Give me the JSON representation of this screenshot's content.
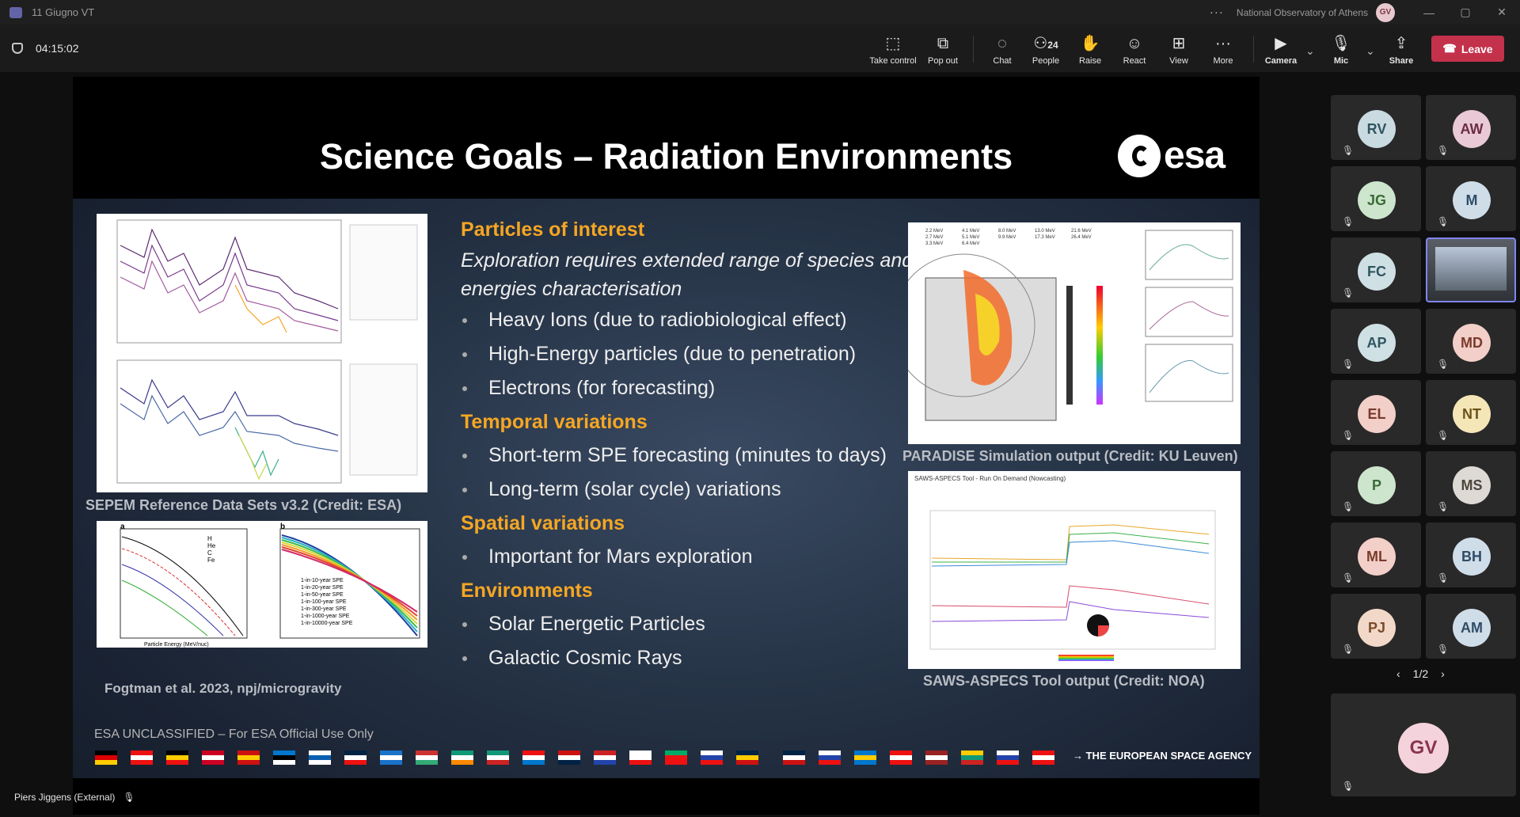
{
  "window": {
    "title": "11 Giugno VT",
    "organization": "National Observatory of Athens",
    "user_initials": "GV",
    "controls": [
      "—",
      "▢",
      "✕"
    ]
  },
  "meeting": {
    "timer": "04:15:02",
    "toolbar": [
      {
        "label": "Take control",
        "icon": "take-control-icon"
      },
      {
        "label": "Pop out",
        "icon": "pop-out-icon"
      },
      {
        "label": "Chat",
        "icon": "chat-icon"
      },
      {
        "label": "People",
        "icon": "people-icon",
        "count": "24"
      },
      {
        "label": "Raise",
        "icon": "raise-hand-icon"
      },
      {
        "label": "React",
        "icon": "react-icon"
      },
      {
        "label": "View",
        "icon": "view-icon"
      },
      {
        "label": "More",
        "icon": "more-icon"
      },
      {
        "label": "Camera",
        "icon": "camera-off-icon"
      },
      {
        "label": "Mic",
        "icon": "mic-off-icon"
      },
      {
        "label": "Share",
        "icon": "share-icon"
      }
    ],
    "leave_label": "Leave"
  },
  "slide": {
    "title": "Science Goals – Radiation Environments",
    "logo_text": "esa",
    "sections": [
      {
        "heading": "Particles of interest",
        "intro": "Exploration requires extended range of species and energies characterisation",
        "items": [
          "Heavy Ions (due to radiobiological effect)",
          "High-Energy particles (due to penetration)",
          "Electrons (for forecasting)"
        ]
      },
      {
        "heading": "Temporal variations",
        "items": [
          "Short-term SPE forecasting (minutes to days)",
          "Long-term (solar cycle) variations"
        ]
      },
      {
        "heading": "Spatial variations",
        "items": [
          "Important for Mars exploration"
        ]
      },
      {
        "heading": "Environments",
        "items": [
          "Solar Energetic Particles",
          "Galactic Cosmic Rays"
        ]
      }
    ],
    "captions": {
      "sepem": "SEPEM Reference Data Sets v3.2 (Credit: ESA)",
      "fogtman": "Fogtman et al. 2023, npj/microgravity",
      "paradise": "PARADISE Simulation output (Credit: KU Leuven)",
      "saws": "SAWS-ASPECS Tool output (Credit: NOA)"
    },
    "figure_text": {
      "fig_a_label": "a",
      "fig_b_label": "b",
      "fig_a_legend": [
        "H",
        "He",
        "C",
        "Fe"
      ],
      "fig_b_legend": [
        "1-in-10-year SPE",
        "1-in-20-year SPE",
        "1-in-50-year SPE",
        "1-in-100-year SPE",
        "1-in-300-year SPE",
        "1-in-1000-year SPE",
        "1-in-10000-year SPE"
      ],
      "x_axis": "Particle Energy (MeV/nuc)",
      "saws_title": "SAWS-ASPECS Tool - Run On Demand (Nowcasting)",
      "paradise_legend": [
        "2.2 MeV",
        "2.7 MeV",
        "3.3 MeV",
        "4.1 MeV",
        "5.1 MeV",
        "6.4 MeV",
        "8.0 MeV",
        "9.9 MeV",
        "13.0 MeV",
        "17.3 MeV",
        "21.6 MeV",
        "26.4 MeV"
      ]
    },
    "footer_note": "ESA UNCLASSIFIED – For ESA Official Use Only",
    "agency": "→ THE EUROPEAN SPACE AGENCY",
    "flag_count": 27
  },
  "presenter": {
    "name": "Piers Jiggens (External)"
  },
  "participants": [
    {
      "initials": "RV",
      "bg": "#c9dbe0",
      "fg": "#2f5560"
    },
    {
      "initials": "AW",
      "bg": "#e9c9d6",
      "fg": "#6d2c45"
    },
    {
      "initials": "JG",
      "bg": "#cde5cc",
      "fg": "#3b6a38"
    },
    {
      "initials": "M",
      "bg": "#cfdde8",
      "fg": "#2f4d66"
    },
    {
      "initials": "FC",
      "bg": "#cfe0e4",
      "fg": "#2f5560"
    },
    {
      "initials": "",
      "bg": "",
      "fg": "",
      "video": true
    },
    {
      "initials": "AP",
      "bg": "#cfe0e4",
      "fg": "#2f5560"
    },
    {
      "initials": "MD",
      "bg": "#f2cfc8",
      "fg": "#7a3a2c"
    },
    {
      "initials": "EL",
      "bg": "#f2cfc8",
      "fg": "#7a3a2c"
    },
    {
      "initials": "NT",
      "bg": "#f5e6b8",
      "fg": "#6b5418"
    },
    {
      "initials": "P",
      "bg": "#cde5cc",
      "fg": "#3b6a38"
    },
    {
      "initials": "MS",
      "bg": "#ddd9d4",
      "fg": "#4d463e"
    },
    {
      "initials": "ML",
      "bg": "#f2cfc8",
      "fg": "#7a3a2c"
    },
    {
      "initials": "BH",
      "bg": "#cfdde8",
      "fg": "#2f4d66"
    },
    {
      "initials": "PJ",
      "bg": "#f2d8c8",
      "fg": "#7a4a2c"
    },
    {
      "initials": "AM",
      "bg": "#cfdde8",
      "fg": "#2f4d66"
    }
  ],
  "pager": {
    "label": "1/2",
    "prev": "‹",
    "next": "›"
  },
  "self_tile": {
    "initials": "GV",
    "bg": "#f5d3dc",
    "fg": "#8a3450"
  }
}
